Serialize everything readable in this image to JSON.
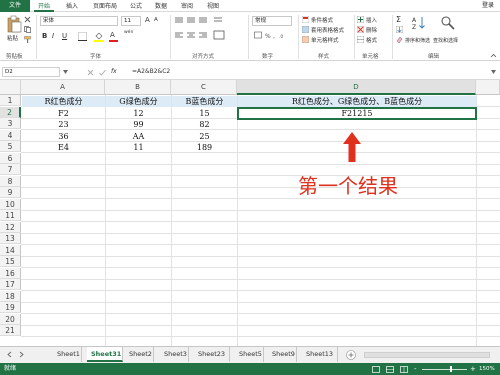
{
  "ribbon_tabs": [
    "文件",
    "开始",
    "插入",
    "页面布局",
    "公式",
    "数据",
    "审阅",
    "视图"
  ],
  "login": "登录",
  "clipboard": {
    "paste": "粘贴",
    "label": "剪贴板"
  },
  "font": {
    "name": "宋体",
    "size": "11",
    "label": "字体",
    "bold": "B",
    "italic": "I",
    "underline": "U",
    "grow": "A",
    "shrink": "A",
    "color_a": "A",
    "wen": "wén"
  },
  "alignment": {
    "label": "对齐方式"
  },
  "number": {
    "format": "常规",
    "label": "数字"
  },
  "styles": {
    "cond": "条件格式",
    "table": "套用表格格式",
    "cell": "单元格样式",
    "label": "样式"
  },
  "cells": {
    "insert": "插入",
    "delete": "删除",
    "format": "格式",
    "label": "单元格"
  },
  "editing": {
    "sum": "Σ",
    "sort": "排序和筛选",
    "find": "查找和选择",
    "label": "编辑"
  },
  "formula_bar": {
    "namebox": "D2",
    "fx": "fx",
    "formula": "=A2&B2&C2"
  },
  "columns": [
    "A",
    "B",
    "C",
    "D"
  ],
  "rows": [
    "1",
    "2",
    "3",
    "4",
    "5",
    "6",
    "7",
    "8",
    "9",
    "10",
    "11",
    "12",
    "13",
    "14",
    "15",
    "16",
    "17",
    "18",
    "19",
    "20",
    "21"
  ],
  "table": {
    "headers": [
      "R红色成分",
      "G绿色成分",
      "B蓝色成分",
      "R红色成分、G绿色成分、B蓝色成分"
    ],
    "data": [
      [
        "F2",
        "12",
        "15",
        "F21215"
      ],
      [
        "23",
        "99",
        "82",
        ""
      ],
      [
        "36",
        "AA",
        "25",
        ""
      ],
      [
        "E4",
        "11",
        "189",
        ""
      ]
    ]
  },
  "annotation": "第一个结果",
  "sheets": [
    "Sheet1",
    "Sheet31",
    "Sheet2",
    "Sheet3",
    "Sheet23",
    "Sheet5",
    "Sheet9",
    "Sheet13"
  ],
  "active_sheet": "Sheet31",
  "status": {
    "ready": "就绪",
    "zoom": "150%",
    "minus": "-",
    "plus": "+"
  },
  "colors": {
    "accent": "#217346",
    "header_fill": "#ddebf7",
    "arrow": "#e0301e"
  }
}
